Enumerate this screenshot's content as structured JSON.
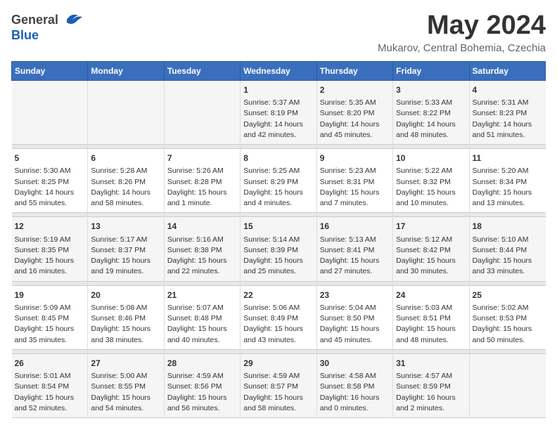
{
  "header": {
    "logo_general": "General",
    "logo_blue": "Blue",
    "title": "May 2024",
    "location": "Mukarov, Central Bohemia, Czechia"
  },
  "days_of_week": [
    "Sunday",
    "Monday",
    "Tuesday",
    "Wednesday",
    "Thursday",
    "Friday",
    "Saturday"
  ],
  "weeks": [
    {
      "days": [
        {
          "date": "",
          "info": ""
        },
        {
          "date": "",
          "info": ""
        },
        {
          "date": "",
          "info": ""
        },
        {
          "date": "1",
          "info": "Sunrise: 5:37 AM\nSunset: 8:19 PM\nDaylight: 14 hours\nand 42 minutes."
        },
        {
          "date": "2",
          "info": "Sunrise: 5:35 AM\nSunset: 8:20 PM\nDaylight: 14 hours\nand 45 minutes."
        },
        {
          "date": "3",
          "info": "Sunrise: 5:33 AM\nSunset: 8:22 PM\nDaylight: 14 hours\nand 48 minutes."
        },
        {
          "date": "4",
          "info": "Sunrise: 5:31 AM\nSunset: 8:23 PM\nDaylight: 14 hours\nand 51 minutes."
        }
      ]
    },
    {
      "days": [
        {
          "date": "5",
          "info": "Sunrise: 5:30 AM\nSunset: 8:25 PM\nDaylight: 14 hours\nand 55 minutes."
        },
        {
          "date": "6",
          "info": "Sunrise: 5:28 AM\nSunset: 8:26 PM\nDaylight: 14 hours\nand 58 minutes."
        },
        {
          "date": "7",
          "info": "Sunrise: 5:26 AM\nSunset: 8:28 PM\nDaylight: 15 hours\nand 1 minute."
        },
        {
          "date": "8",
          "info": "Sunrise: 5:25 AM\nSunset: 8:29 PM\nDaylight: 15 hours\nand 4 minutes."
        },
        {
          "date": "9",
          "info": "Sunrise: 5:23 AM\nSunset: 8:31 PM\nDaylight: 15 hours\nand 7 minutes."
        },
        {
          "date": "10",
          "info": "Sunrise: 5:22 AM\nSunset: 8:32 PM\nDaylight: 15 hours\nand 10 minutes."
        },
        {
          "date": "11",
          "info": "Sunrise: 5:20 AM\nSunset: 8:34 PM\nDaylight: 15 hours\nand 13 minutes."
        }
      ]
    },
    {
      "days": [
        {
          "date": "12",
          "info": "Sunrise: 5:19 AM\nSunset: 8:35 PM\nDaylight: 15 hours\nand 16 minutes."
        },
        {
          "date": "13",
          "info": "Sunrise: 5:17 AM\nSunset: 8:37 PM\nDaylight: 15 hours\nand 19 minutes."
        },
        {
          "date": "14",
          "info": "Sunrise: 5:16 AM\nSunset: 8:38 PM\nDaylight: 15 hours\nand 22 minutes."
        },
        {
          "date": "15",
          "info": "Sunrise: 5:14 AM\nSunset: 8:39 PM\nDaylight: 15 hours\nand 25 minutes."
        },
        {
          "date": "16",
          "info": "Sunrise: 5:13 AM\nSunset: 8:41 PM\nDaylight: 15 hours\nand 27 minutes."
        },
        {
          "date": "17",
          "info": "Sunrise: 5:12 AM\nSunset: 8:42 PM\nDaylight: 15 hours\nand 30 minutes."
        },
        {
          "date": "18",
          "info": "Sunrise: 5:10 AM\nSunset: 8:44 PM\nDaylight: 15 hours\nand 33 minutes."
        }
      ]
    },
    {
      "days": [
        {
          "date": "19",
          "info": "Sunrise: 5:09 AM\nSunset: 8:45 PM\nDaylight: 15 hours\nand 35 minutes."
        },
        {
          "date": "20",
          "info": "Sunrise: 5:08 AM\nSunset: 8:46 PM\nDaylight: 15 hours\nand 38 minutes."
        },
        {
          "date": "21",
          "info": "Sunrise: 5:07 AM\nSunset: 8:48 PM\nDaylight: 15 hours\nand 40 minutes."
        },
        {
          "date": "22",
          "info": "Sunrise: 5:06 AM\nSunset: 8:49 PM\nDaylight: 15 hours\nand 43 minutes."
        },
        {
          "date": "23",
          "info": "Sunrise: 5:04 AM\nSunset: 8:50 PM\nDaylight: 15 hours\nand 45 minutes."
        },
        {
          "date": "24",
          "info": "Sunrise: 5:03 AM\nSunset: 8:51 PM\nDaylight: 15 hours\nand 48 minutes."
        },
        {
          "date": "25",
          "info": "Sunrise: 5:02 AM\nSunset: 8:53 PM\nDaylight: 15 hours\nand 50 minutes."
        }
      ]
    },
    {
      "days": [
        {
          "date": "26",
          "info": "Sunrise: 5:01 AM\nSunset: 8:54 PM\nDaylight: 15 hours\nand 52 minutes."
        },
        {
          "date": "27",
          "info": "Sunrise: 5:00 AM\nSunset: 8:55 PM\nDaylight: 15 hours\nand 54 minutes."
        },
        {
          "date": "28",
          "info": "Sunrise: 4:59 AM\nSunset: 8:56 PM\nDaylight: 15 hours\nand 56 minutes."
        },
        {
          "date": "29",
          "info": "Sunrise: 4:59 AM\nSunset: 8:57 PM\nDaylight: 15 hours\nand 58 minutes."
        },
        {
          "date": "30",
          "info": "Sunrise: 4:58 AM\nSunset: 8:58 PM\nDaylight: 16 hours\nand 0 minutes."
        },
        {
          "date": "31",
          "info": "Sunrise: 4:57 AM\nSunset: 8:59 PM\nDaylight: 16 hours\nand 2 minutes."
        },
        {
          "date": "",
          "info": ""
        }
      ]
    }
  ]
}
